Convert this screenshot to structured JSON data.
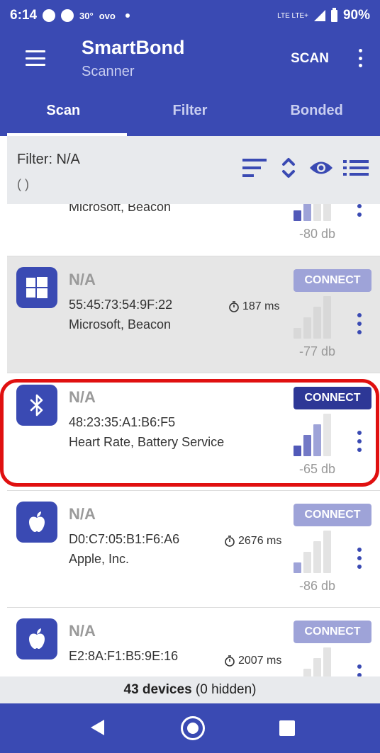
{
  "status_bar": {
    "time": "6:14",
    "temperature": "30°",
    "carrier": "ovo",
    "network": "LTE LTE+",
    "battery": "90%"
  },
  "app_bar": {
    "title": "SmartBond",
    "subtitle": "Scanner",
    "scan_label": "SCAN"
  },
  "tabs": [
    {
      "label": "Scan",
      "active": true
    },
    {
      "label": "Filter",
      "active": false
    },
    {
      "label": "Bonded",
      "active": false
    }
  ],
  "filter": {
    "label": "Filter: N/A",
    "sub": "( )"
  },
  "devices": [
    {
      "name": "",
      "address": "",
      "services": "Microsoft, Beacon",
      "interval": "",
      "connect_label": "",
      "rssi": "-80 db"
    },
    {
      "name": "N/A",
      "address": "55:45:73:54:9F:22",
      "services": "Microsoft, Beacon",
      "interval": "187 ms",
      "connect_label": "CONNECT",
      "rssi": "-77 db",
      "icon": "windows-icon"
    },
    {
      "name": "N/A",
      "address": "48:23:35:A1:B6:F5",
      "services": "Heart Rate, Battery Service",
      "interval": "",
      "connect_label": "CONNECT",
      "rssi": "-65 db",
      "icon": "bluetooth-icon"
    },
    {
      "name": "N/A",
      "address": "D0:C7:05:B1:F6:A6",
      "services": "Apple, Inc.",
      "interval": "2676 ms",
      "connect_label": "CONNECT",
      "rssi": "-86 db",
      "icon": "apple-icon"
    },
    {
      "name": "N/A",
      "address": "E2:8A:F1:B5:9E:16",
      "services": "",
      "interval": "2007 ms",
      "connect_label": "CONNECT",
      "rssi": "",
      "icon": "apple-icon"
    }
  ],
  "footer": {
    "count": "43 devices",
    "hidden": "(0 hidden)"
  },
  "colors": {
    "primary": "#3a4ab3",
    "highlight": "#e01010",
    "connect_light": "#9ea3d8",
    "connect_dark": "#2d3796"
  }
}
